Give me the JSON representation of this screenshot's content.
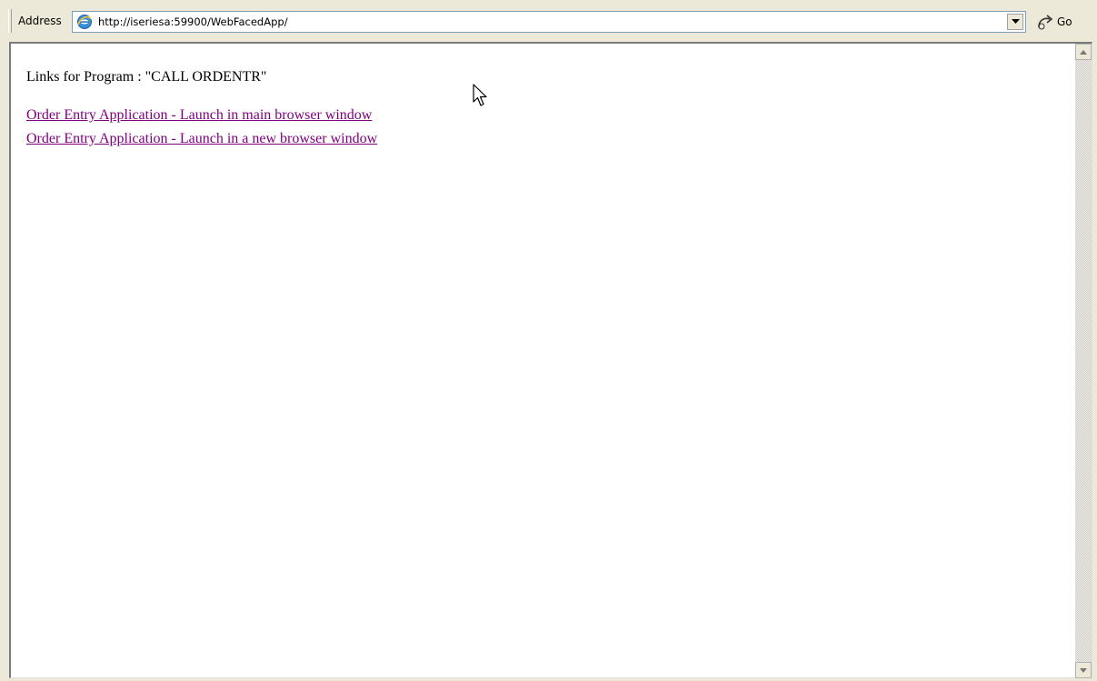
{
  "address_bar": {
    "label": "Address",
    "url": "http://iseriesa:59900/WebFacedApp/",
    "go_label": "Go"
  },
  "page": {
    "heading": "Links for Program : \"CALL ORDENTR\"",
    "links": [
      {
        "label": "Order Entry Application - Launch in main browser window"
      },
      {
        "label": "Order Entry Application - Launch in a new browser window"
      }
    ]
  },
  "colors": {
    "visited_link": "#800080",
    "chrome": "#ece9d8"
  },
  "icons": [
    "ie-page-icon",
    "chevron-down-icon",
    "go-arrow-icon",
    "scroll-up-icon",
    "scroll-down-icon",
    "mouse-pointer-icon"
  ]
}
